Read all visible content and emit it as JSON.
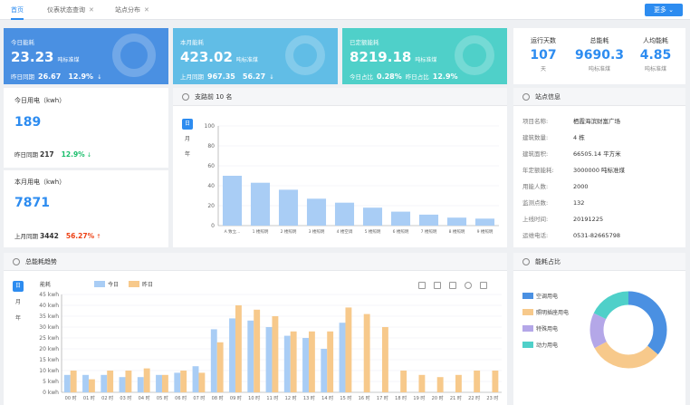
{
  "tabs": [
    {
      "label": "首页",
      "active": true
    },
    {
      "label": "仪表状态查询",
      "closable": true
    },
    {
      "label": "站点分布",
      "closable": true
    }
  ],
  "top_button": {
    "label": "更多"
  },
  "kpis": [
    {
      "title": "今日能耗",
      "value": "23.23",
      "unit": "吨标准煤",
      "sub_label": "昨日同期",
      "sub_value": "26.67",
      "pct": "12.9%",
      "arrow": "↓",
      "color": "#4a90e2"
    },
    {
      "title": "本月能耗",
      "value": "423.02",
      "unit": "吨标准煤",
      "sub_label": "上月同期",
      "sub_value": "967.35",
      "pct": "56.27",
      "arrow": "↓",
      "color": "#61bde6"
    },
    {
      "title": "已定额能耗",
      "value": "8219.18",
      "unit": "吨标准煤",
      "sub_label": "今日占比",
      "sub_value": "0.28%",
      "sub_label2": "昨日占比",
      "sub_value2": "12.9%",
      "color": "#4fd0c9"
    }
  ],
  "stats": [
    {
      "label": "运行天数",
      "value": "107",
      "unit": "天"
    },
    {
      "label": "总能耗",
      "value": "9690.3",
      "unit": "吨标准煤"
    },
    {
      "label": "人均能耗",
      "value": "4.85",
      "unit": "吨标准煤"
    }
  ],
  "today_elec": {
    "title": "今日用电（kwh）",
    "value": "189",
    "cmp_label": "昨日同期",
    "cmp_value": "217",
    "pct": "12.9%",
    "arrow": "↓"
  },
  "month_elec": {
    "title": "本月用电（kwh）",
    "value": "7871",
    "cmp_label": "上月同期",
    "cmp_value": "3442",
    "pct": "56.27%",
    "arrow": "↑"
  },
  "top10": {
    "title": "支路前 10 名",
    "segments": [
      "日",
      "月",
      "年"
    ]
  },
  "station": {
    "title": "站点信息",
    "rows": [
      {
        "k": "项目名称:",
        "v": "栖霞海滨财富广场"
      },
      {
        "k": "建筑数量:",
        "v": "4 栋"
      },
      {
        "k": "建筑面积:",
        "v": "66505.14 平方米"
      },
      {
        "k": "年定额能耗:",
        "v": "3000000 吨标准煤"
      },
      {
        "k": "用能人数:",
        "v": "2000"
      },
      {
        "k": "监测点数:",
        "v": "132"
      },
      {
        "k": "上线时间:",
        "v": "20191225"
      },
      {
        "k": "运维电话:",
        "v": "0531-82665798"
      }
    ]
  },
  "trend": {
    "title": "总能耗趋势",
    "segments": [
      "日",
      "月",
      "年"
    ]
  },
  "ratio": {
    "title": "能耗占比"
  },
  "chart_data": [
    {
      "type": "bar",
      "title": "支路前 10 名",
      "categories": [
        "A 致立...",
        "1 楼照明",
        "2 楼照明",
        "3 楼照明",
        "4 楼空调",
        "5 楼照明",
        "6 楼照明",
        "7 楼照明",
        "8 楼照明",
        "9 楼照明"
      ],
      "values": [
        50,
        43,
        36,
        27,
        23,
        18,
        14,
        11,
        8,
        7
      ],
      "ylim": [
        0,
        100
      ],
      "yticks": [
        0,
        20,
        40,
        60,
        80,
        100
      ],
      "color": "#a9cdf5"
    },
    {
      "type": "bar",
      "title": "总能耗趋势",
      "ylabel": "能耗",
      "categories": [
        "00 时",
        "01 时",
        "02 时",
        "03 时",
        "04 时",
        "05 时",
        "06 时",
        "07 时",
        "08 时",
        "09 时",
        "10 时",
        "11 时",
        "12 时",
        "13 时",
        "14 时",
        "15 时",
        "16 时",
        "17 时",
        "18 时",
        "19 时",
        "20 时",
        "21 时",
        "22 时",
        "23 时"
      ],
      "yticks": [
        "0 kwh",
        "5 kwh",
        "10 kwh",
        "15 kwh",
        "20 kwh",
        "25 kwh",
        "30 kwh",
        "35 kwh",
        "40 kwh",
        "45 kwh"
      ],
      "ylim": [
        0,
        45
      ],
      "series": [
        {
          "name": "今日",
          "color": "#a9cdf5",
          "values": [
            8,
            8,
            8,
            7,
            7,
            8,
            9,
            12,
            29,
            34,
            33,
            30,
            26,
            25,
            20,
            32,
            0,
            0,
            0,
            0,
            0,
            0,
            0,
            0
          ]
        },
        {
          "name": "昨日",
          "color": "#f7c98b",
          "values": [
            10,
            6,
            10,
            10,
            11,
            8,
            10,
            9,
            23,
            40,
            38,
            35,
            28,
            28,
            28,
            39,
            36,
            30,
            10,
            8,
            7,
            8,
            10,
            10
          ]
        }
      ]
    },
    {
      "type": "pie",
      "title": "能耗占比",
      "labels": [
        "空调用电",
        "照明插座用电",
        "特殊用电",
        "动力用电"
      ],
      "values": [
        36,
        31,
        15,
        18
      ],
      "colors": [
        "#4a90e2",
        "#f7c98b",
        "#b4a7e8",
        "#4fd0c9"
      ]
    }
  ]
}
